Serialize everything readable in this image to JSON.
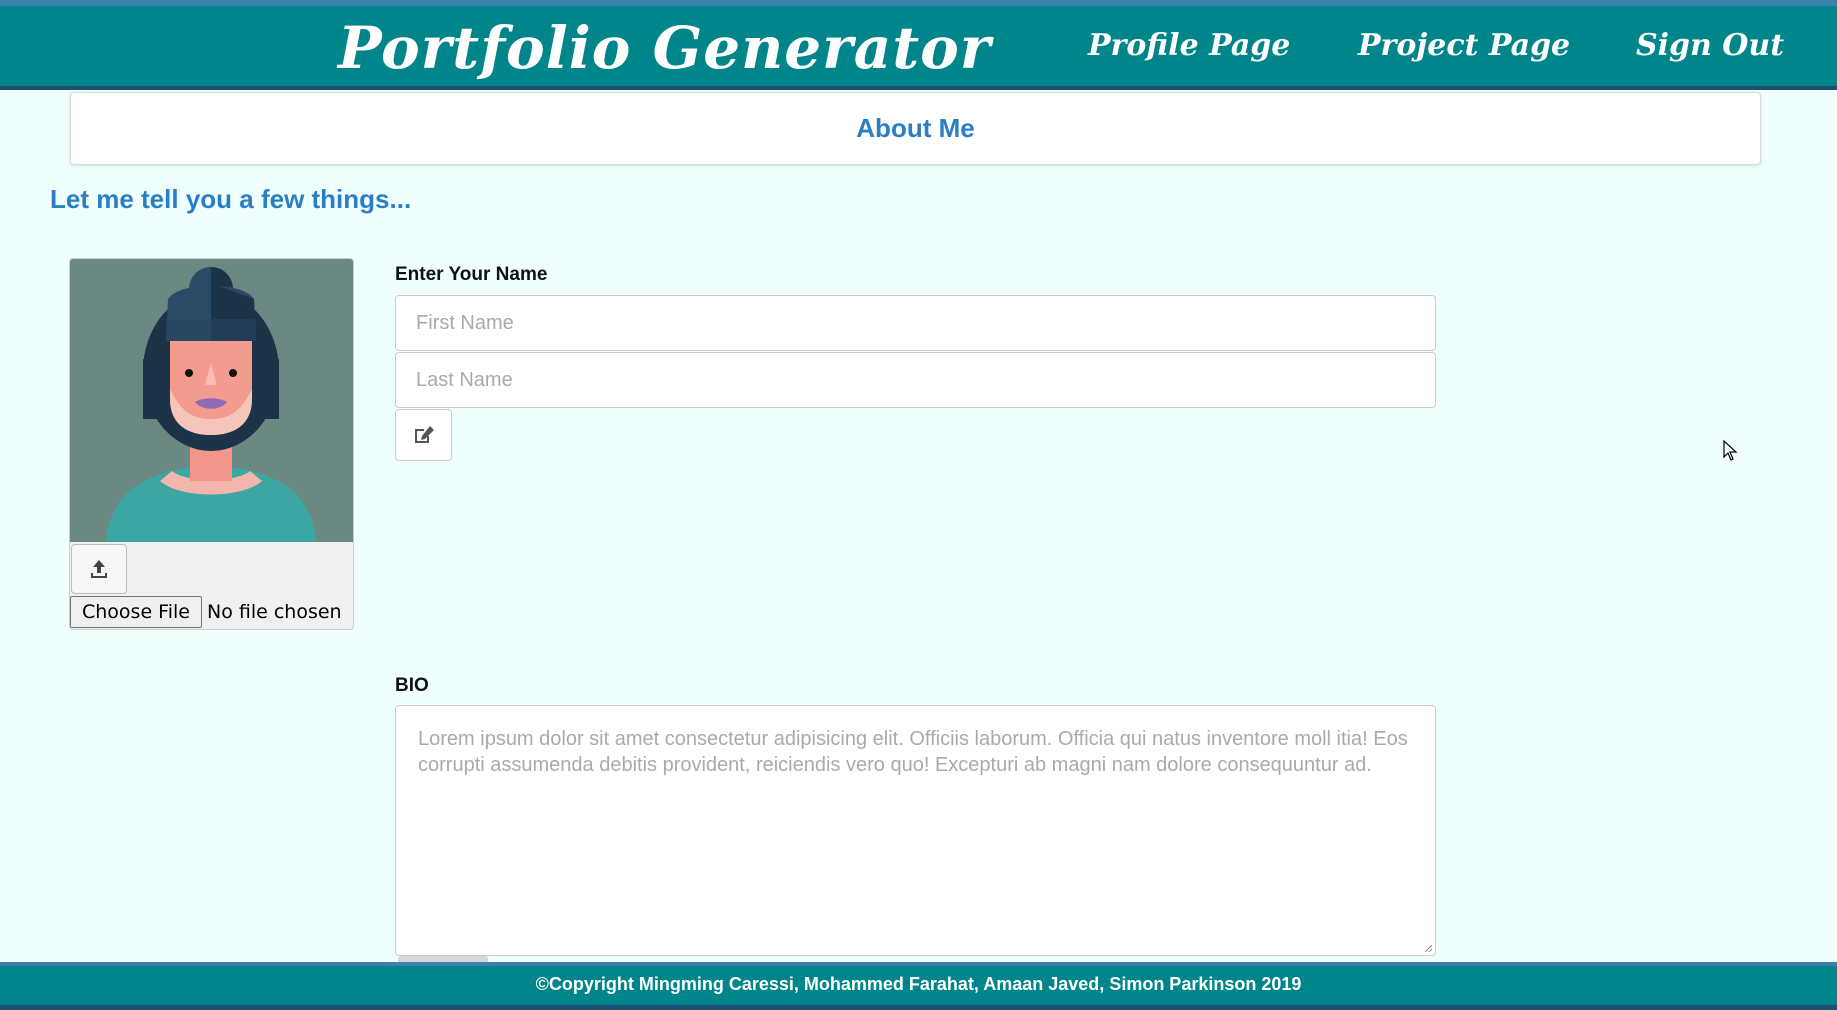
{
  "header": {
    "brand": "Portfolio Generator",
    "nav": {
      "profile": "Profile Page",
      "project": "Project Page",
      "signout": "Sign Out"
    }
  },
  "about": {
    "title": "About Me",
    "tagline": "Let me tell you a few things..."
  },
  "avatar": {
    "icon": "woman-avatar-illustration",
    "upload_icon": "upload-icon",
    "choose_file_label": "Choose File",
    "file_status": "No file chosen"
  },
  "name_form": {
    "label": "Enter Your Name",
    "first_placeholder": "First Name",
    "last_placeholder": "Last Name",
    "edit_icon": "edit-icon"
  },
  "bio": {
    "label": "BIO",
    "placeholder": "Lorem ipsum dolor sit amet consectetur adipisicing elit.  Officiis laborum. Officia qui natus inventore  moll itia! Eos corrupti assumenda debitis provident,  reiciendis vero quo! Excepturi ab magni nam dolore consequuntur ad."
  },
  "footer": {
    "copyright": "©Copyright Mingming Caressi, Mohammed Farahat, Amaan Javed, Simon Parkinson 2019"
  },
  "colors": {
    "header_bg": "#00868a",
    "accent_text": "#2a7fc4",
    "page_bg": "#eefffe"
  }
}
